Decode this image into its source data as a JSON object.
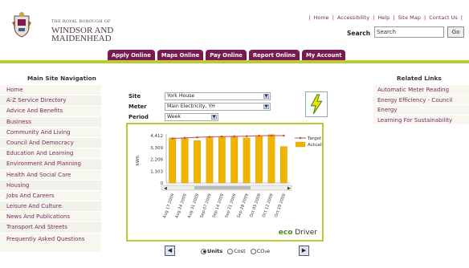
{
  "header": {
    "logo_small": "THE ROYAL BOROUGH OF",
    "logo_line1": "WINDSOR AND",
    "logo_line2": "MAIDENHEAD",
    "top_links": [
      "Home",
      "Accessibility",
      "Help",
      "Site Map",
      "Contact Us"
    ],
    "search_label": "Search",
    "search_value": "Search",
    "search_button": "Go"
  },
  "nav_tabs": [
    "Apply Online",
    "Maps Online",
    "Pay Online",
    "Report Online",
    "My Account"
  ],
  "left_nav": {
    "title": "Main Site Navigation",
    "items": [
      "Home",
      "A-Z Service Directory",
      "Advice And Benefits",
      "Business",
      "Community And Living",
      "Council And Democracy",
      "Education And Learning",
      "Environment And Planning",
      "Health And Social Care",
      "Housing",
      "Jobs And Careers",
      "Leisure And Culture",
      "News And Publications",
      "Transport And Streets",
      "Frequently Asked Questions"
    ]
  },
  "form": {
    "site_label": "Site",
    "site_value": "York House",
    "meter_label": "Meter",
    "meter_value": "Main Electricity, YH",
    "period_label": "Period",
    "period_value": "Week"
  },
  "chart_data": {
    "type": "bar",
    "ylabel": "kWh",
    "yticks": [
      "4,412",
      "3,309",
      "2,206",
      "1,103",
      "0"
    ],
    "ylim": [
      0,
      4412
    ],
    "categories": [
      "Aug 17 2009",
      "Aug 24 2009",
      "Aug 31 2009",
      "Sep 07 2009",
      "Sep 14 2009",
      "Sep 21 2009",
      "Sep 28 2009",
      "Oct 05 2009",
      "Oct 12 2009",
      "Oct 19 2009"
    ],
    "series": [
      {
        "name": "Target",
        "values": [
          4150,
          4200,
          4250,
          4300,
          4320,
          4340,
          4360,
          4400,
          4412,
          4412
        ]
      },
      {
        "name": "Actuals",
        "values": [
          4200,
          4150,
          3950,
          4250,
          4300,
          4280,
          4200,
          4350,
          4500,
          3400
        ]
      }
    ],
    "colors": {
      "Target": "#c0504d",
      "Actuals": "#f0b400"
    }
  },
  "chart_footer": {
    "brand_eco": "eco",
    "brand_driver": "Driver"
  },
  "units": {
    "options": [
      "Units",
      "Cost",
      "CO₂e"
    ],
    "selected": "Units"
  },
  "related": {
    "title": "Related Links",
    "items": [
      "Automatic Meter Reading",
      "Energy Efficiency - Council",
      "Energy",
      "Learning For Sustainability"
    ]
  }
}
